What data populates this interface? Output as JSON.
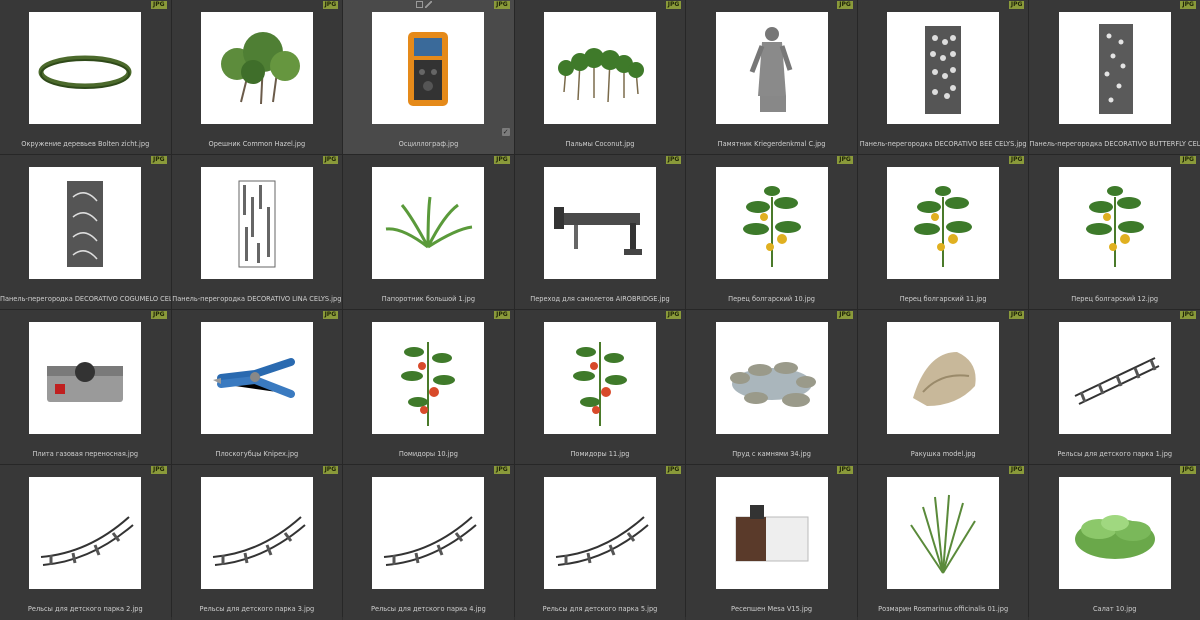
{
  "badge_label": "JPG",
  "items": [
    {
      "caption": "Окружение деревьев Bolten zicht.jpg",
      "icon": "tree-ring-icon"
    },
    {
      "caption": "Орешник Common Hazel.jpg",
      "icon": "hazel-bush-icon"
    },
    {
      "caption": "Осциллограф.jpg",
      "icon": "oscilloscope-icon",
      "selected": true
    },
    {
      "caption": "Пальмы Coconut.jpg",
      "icon": "palms-icon"
    },
    {
      "caption": "Памятник Kriegerdenkmal C.jpg",
      "icon": "statue-icon"
    },
    {
      "caption": "Панель-перегородка DECORATIVO BEE CELYS.jpg",
      "icon": "panel-bee-icon"
    },
    {
      "caption": "Панель-перегородка DECORATIVO BUTTERFLY CELYS.jpg",
      "icon": "panel-butterfly-icon"
    },
    {
      "caption": "Панель-перегородка DECORATIVO COGUMELO CELYS.jpg",
      "icon": "panel-leaf-icon"
    },
    {
      "caption": "Панель-перегородка DECORATIVO LINA CELYS.jpg",
      "icon": "panel-lines-icon"
    },
    {
      "caption": "Папоротник большой 1.jpg",
      "icon": "fern-icon"
    },
    {
      "caption": "Переход для самолетов AIROBRIDGE.jpg",
      "icon": "airbridge-icon"
    },
    {
      "caption": "Перец болгарский 10.jpg",
      "icon": "pepper-plant-icon"
    },
    {
      "caption": "Перец болгарский 11.jpg",
      "icon": "pepper-plant-icon"
    },
    {
      "caption": "Перец болгарский 12.jpg",
      "icon": "pepper-plant-icon"
    },
    {
      "caption": "Плита газовая переносная.jpg",
      "icon": "gas-stove-icon"
    },
    {
      "caption": "Плоскогубцы Knipex.jpg",
      "icon": "pliers-icon"
    },
    {
      "caption": "Помидоры 10.jpg",
      "icon": "tomato-plant-icon"
    },
    {
      "caption": "Помидоры 11.jpg",
      "icon": "tomato-plant-icon"
    },
    {
      "caption": "Пруд с камнями 34.jpg",
      "icon": "pond-stones-icon"
    },
    {
      "caption": "Ракушка model.jpg",
      "icon": "seashell-icon"
    },
    {
      "caption": "Рельсы для детского парка 1.jpg",
      "icon": "rails-straight-icon"
    },
    {
      "caption": "Рельсы для детского парка 2.jpg",
      "icon": "rails-curve-icon"
    },
    {
      "caption": "Рельсы для детского парка 3.jpg",
      "icon": "rails-curve-icon"
    },
    {
      "caption": "Рельсы для детского парка 4.jpg",
      "icon": "rails-curve-icon"
    },
    {
      "caption": "Рельсы для детского парка 5.jpg",
      "icon": "rails-curve-icon"
    },
    {
      "caption": "Ресепшен Mesa V15.jpg",
      "icon": "reception-desk-icon"
    },
    {
      "caption": "Розмарин Rosmarinus officinalis 01.jpg",
      "icon": "rosemary-icon"
    },
    {
      "caption": "Салат 10.jpg",
      "icon": "lettuce-icon"
    }
  ],
  "colors": {
    "background": "#2f2f2f",
    "cell": "#383838",
    "badge": "#8a9a3a",
    "caption_text": "#cfcfcf"
  }
}
